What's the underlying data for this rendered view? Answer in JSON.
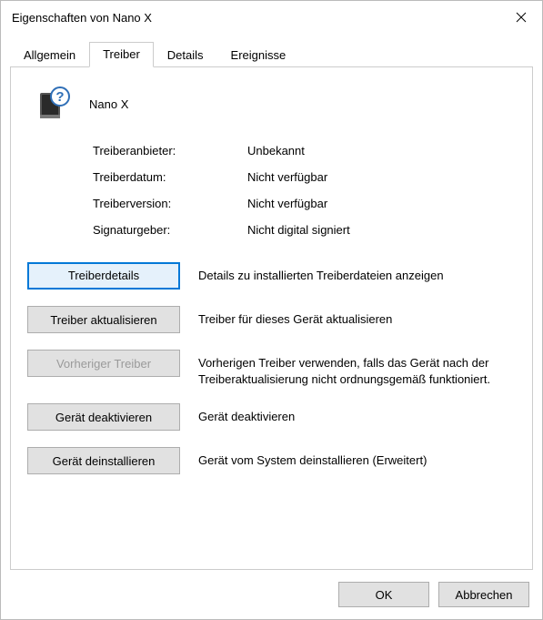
{
  "window": {
    "title": "Eigenschaften von Nano X"
  },
  "tabs": {
    "general": "Allgemein",
    "driver": "Treiber",
    "details": "Details",
    "events": "Ereignisse",
    "active": "driver"
  },
  "device": {
    "name": "Nano X"
  },
  "info": {
    "provider_label": "Treiberanbieter:",
    "provider_value": "Unbekannt",
    "date_label": "Treiberdatum:",
    "date_value": "Nicht verfügbar",
    "version_label": "Treiberversion:",
    "version_value": "Nicht verfügbar",
    "signer_label": "Signaturgeber:",
    "signer_value": "Nicht digital signiert"
  },
  "actions": {
    "details": {
      "button": "Treiberdetails",
      "desc": "Details zu installierten Treiberdateien anzeigen"
    },
    "update": {
      "button": "Treiber aktualisieren",
      "desc": "Treiber für dieses Gerät aktualisieren"
    },
    "rollback": {
      "button": "Vorheriger Treiber",
      "desc": "Vorherigen Treiber verwenden, falls das Gerät nach der Treiberaktualisierung nicht ordnungsgemäß funktioniert."
    },
    "disable": {
      "button": "Gerät deaktivieren",
      "desc": "Gerät deaktivieren"
    },
    "uninstall": {
      "button": "Gerät deinstallieren",
      "desc": "Gerät vom System deinstallieren (Erweitert)"
    }
  },
  "footer": {
    "ok": "OK",
    "cancel": "Abbrechen"
  }
}
